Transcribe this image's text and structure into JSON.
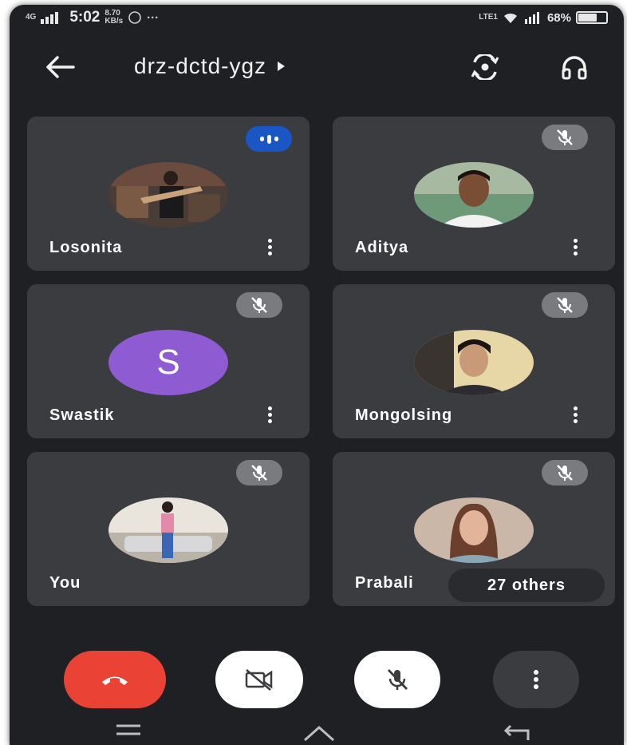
{
  "status_bar": {
    "network_left": "4G",
    "time": "5:02",
    "speed_value": "8.70",
    "speed_unit": "KB/s",
    "volte": "LTE1",
    "battery_percent": "68%",
    "battery_level": 0.68
  },
  "meeting": {
    "code": "drz-dctd-ygz"
  },
  "participants": [
    {
      "name": "Losonita",
      "status": "speaking",
      "avatar": "photo"
    },
    {
      "name": "Aditya",
      "status": "muted",
      "avatar": "photo"
    },
    {
      "name": "Swastik",
      "status": "muted",
      "avatar": "letter",
      "initial": "S",
      "color": "#8f5bd2"
    },
    {
      "name": "Mongolsing",
      "status": "muted",
      "avatar": "photo"
    },
    {
      "name": "You",
      "status": "muted",
      "avatar": "photo"
    },
    {
      "name": "Prabali",
      "status": "muted",
      "avatar": "photo"
    }
  ],
  "others_label": "27 others",
  "controls": {
    "end_call_color": "#ea4335",
    "icons": [
      "phone-hangup-icon",
      "video-off-icon",
      "mic-off-icon",
      "more-vert-icon"
    ]
  },
  "colors": {
    "background": "#1f2023",
    "tile": "#3b3c40",
    "speaking": "#1a56c4"
  }
}
